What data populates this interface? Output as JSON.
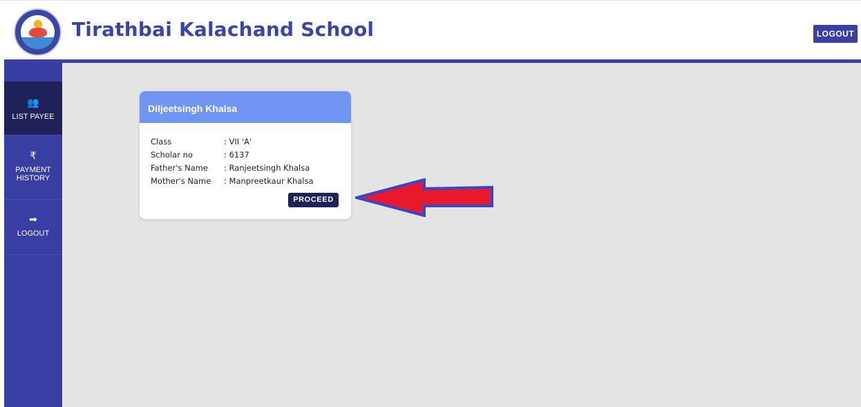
{
  "header": {
    "title": "Tirathbai Kalachand School",
    "logout_label": "LOGOUT",
    "logo_icon": "school-logo-icon"
  },
  "sidebar": {
    "items": [
      {
        "label": "LIST PAYEE",
        "icon": "users-icon",
        "glyph": "👥",
        "active": true
      },
      {
        "label_line1": "PAYMENT",
        "label_line2": "HISTORY",
        "icon": "rupee-icon",
        "glyph": "₹",
        "active": false
      },
      {
        "label": "LOGOUT",
        "icon": "sign-out-icon",
        "glyph": "➡",
        "active": false
      }
    ]
  },
  "student_card": {
    "name": "Diljeetsingh Khalsa",
    "fields": [
      {
        "label": "Class",
        "value": ": VII 'A'"
      },
      {
        "label": "Scholar no",
        "value": ": 6137"
      },
      {
        "label": "Father's Name",
        "value": ": Ranjeetsingh Khalsa"
      },
      {
        "label": "Mother's Name",
        "value": ": Manpreetkaur Khalsa"
      }
    ],
    "proceed_label": "PROCEED"
  },
  "colors": {
    "primary": "#3a3ea6",
    "sidebar_active": "#1f2159",
    "card_header": "#7195f2",
    "arrow_fill": "#e8192c",
    "arrow_outline": "#3a46c8",
    "content_bg": "#e4e4e4"
  },
  "annotation": {
    "icon": "red-arrow-icon",
    "points_to": "proceed-button"
  }
}
